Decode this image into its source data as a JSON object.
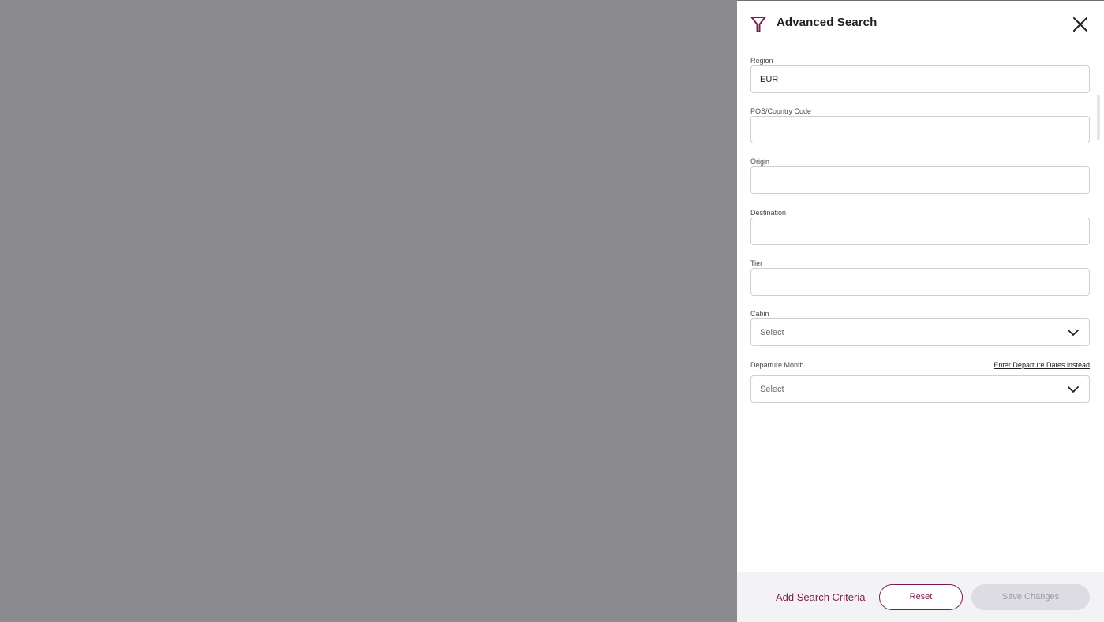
{
  "panel": {
    "title": "Advanced Search",
    "icons": {
      "filter": "filter-icon",
      "close": "close-icon"
    },
    "accent_color": "#7a1e4e"
  },
  "fields": {
    "region": {
      "label": "Region",
      "value": "EUR"
    },
    "pos_country_code": {
      "label": "POS/Country Code",
      "value": ""
    },
    "origin": {
      "label": "Origin",
      "value": ""
    },
    "destination": {
      "label": "Destination",
      "value": ""
    },
    "tier": {
      "label": "Tier",
      "value": ""
    },
    "cabin": {
      "label": "Cabin",
      "selected": "Select"
    },
    "departure_month": {
      "label": "Departure Month",
      "selected": "Select",
      "link": "Enter Departure Dates instead"
    }
  },
  "footer": {
    "add_criteria": "Add Search Criteria",
    "reset_label": "Reset",
    "save_label": "Save Changes"
  }
}
